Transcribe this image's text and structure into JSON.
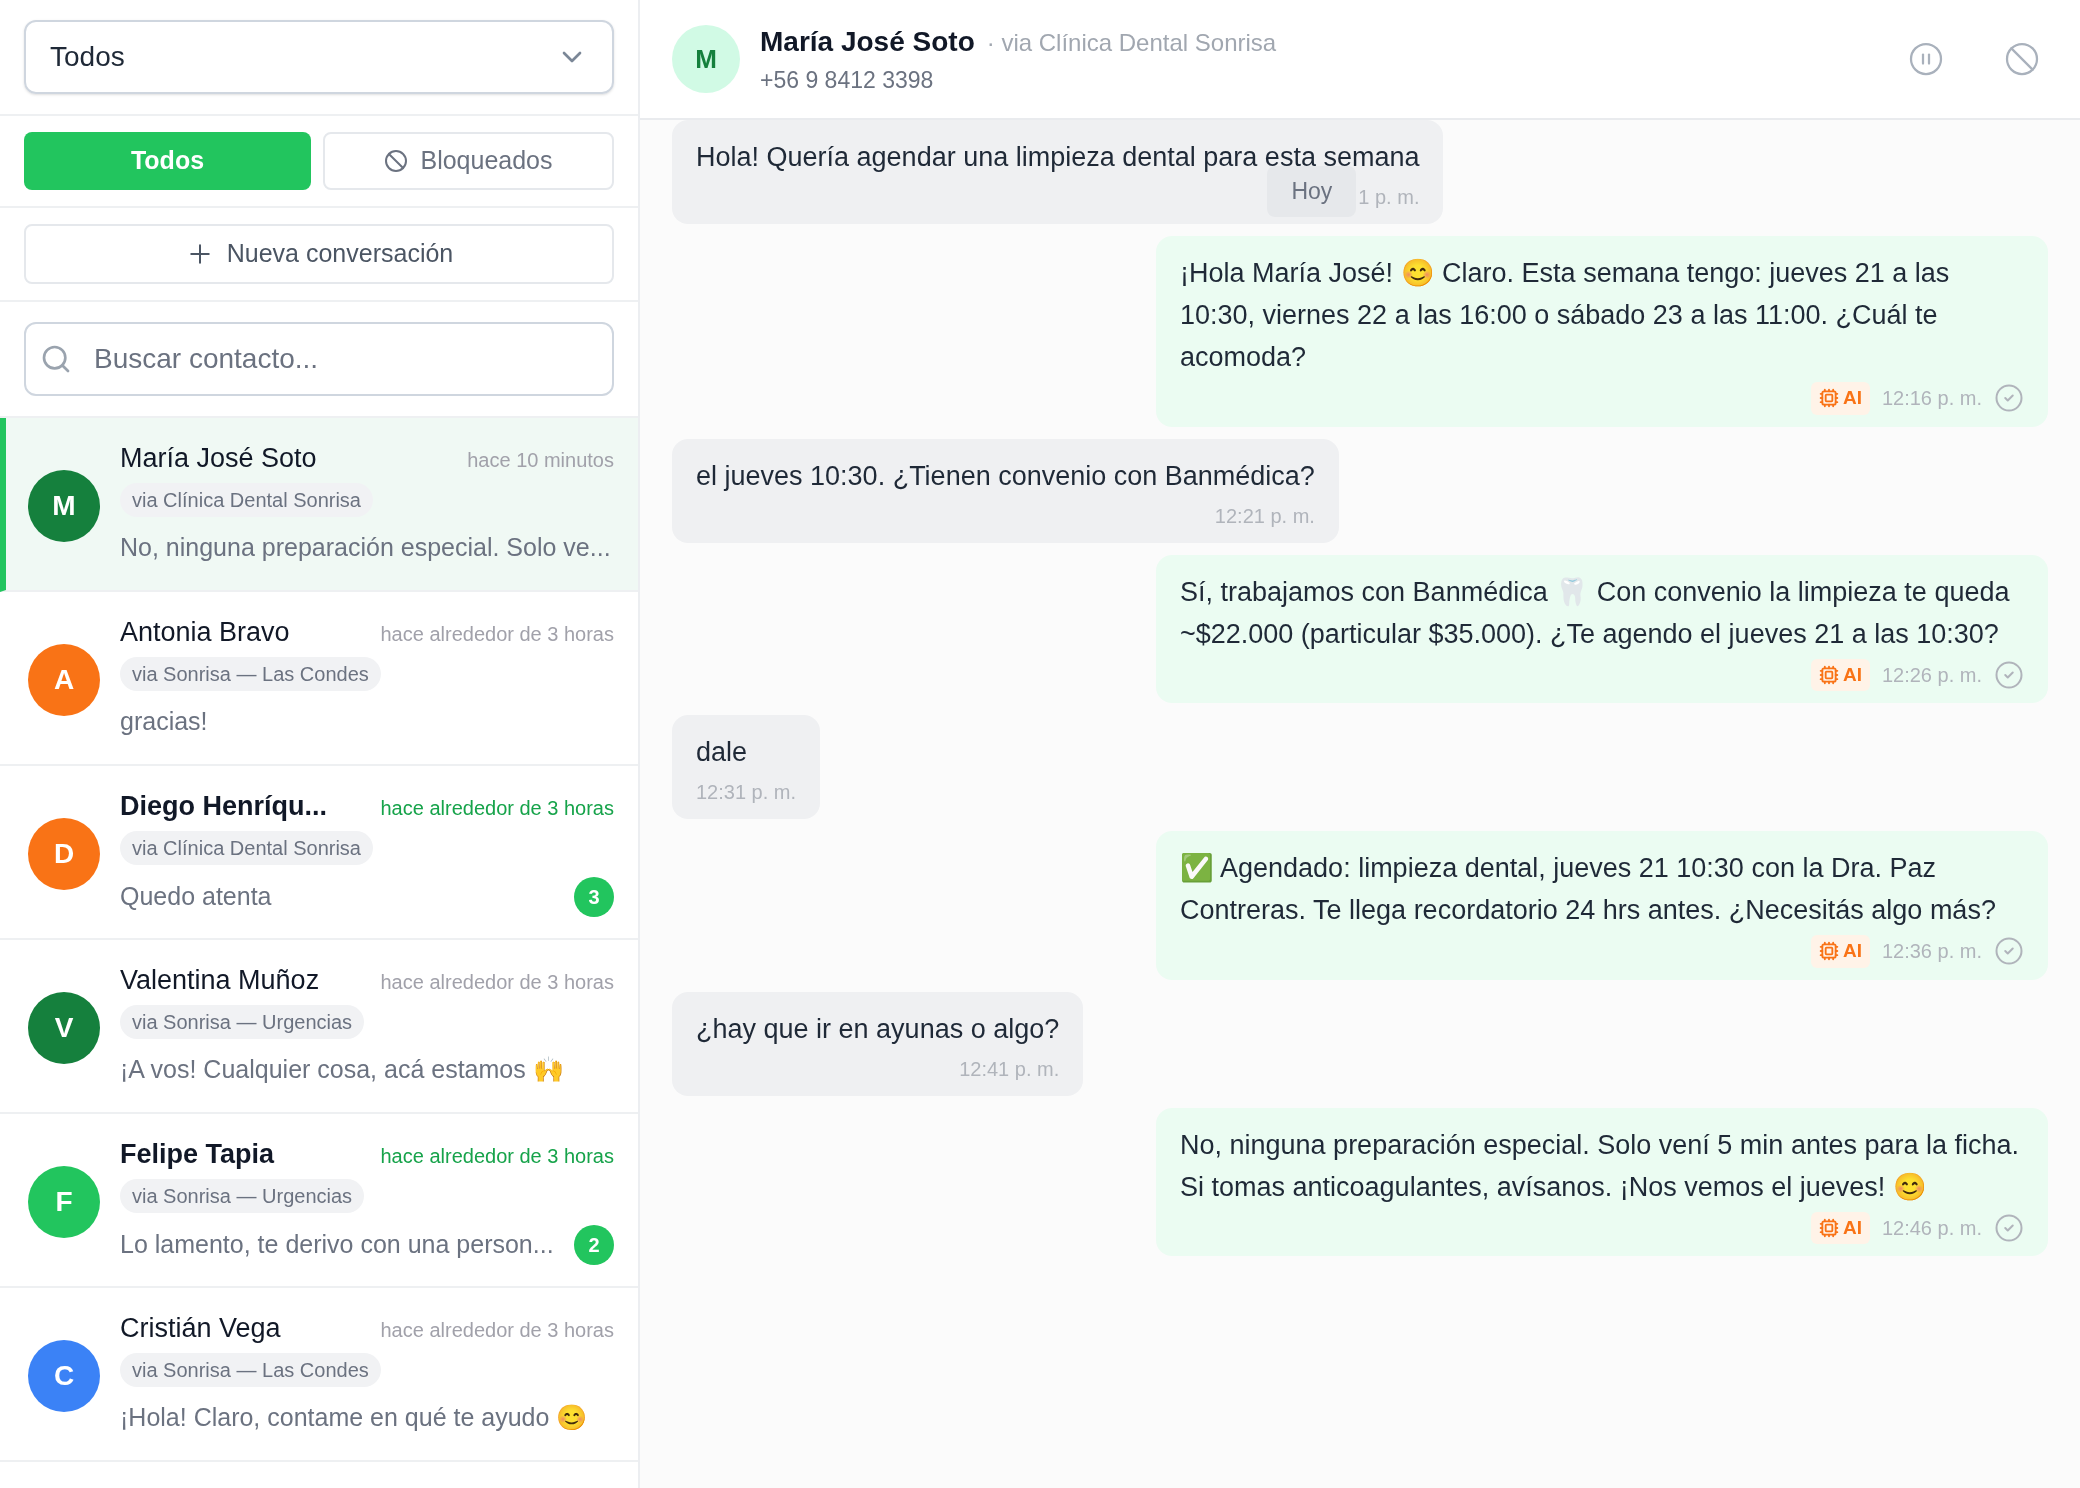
{
  "sidebar": {
    "filter": {
      "value": "Todos"
    },
    "tabs": [
      {
        "label": "Todos",
        "kind": "all",
        "selected": true
      },
      {
        "label": "Bloqueados",
        "kind": "blocked",
        "selected": false
      }
    ],
    "new_button": "Nueva conversación",
    "search": {
      "placeholder": "Buscar contacto..."
    },
    "conversations": [
      {
        "initial": "M",
        "color": "#15803d",
        "name": "María José Soto",
        "time": "hace 10 minutos",
        "channel": "via Clínica Dental Sonrisa",
        "preview": "No, ninguna preparación especial. Solo ve...",
        "selected": true,
        "unread": false
      },
      {
        "initial": "A",
        "color": "#f97316",
        "name": "Antonia Bravo",
        "time": "hace alrededor de 3 horas",
        "channel": "via Sonrisa — Las Condes",
        "preview": "gracias!",
        "selected": false,
        "unread": false
      },
      {
        "initial": "D",
        "color": "#f97316",
        "name": "Diego Henríqu...",
        "time": "hace alrededor de 3 horas",
        "channel": "via Clínica Dental Sonrisa",
        "preview": "Quedo atenta",
        "selected": false,
        "unread": true,
        "count": "3"
      },
      {
        "initial": "V",
        "color": "#15803d",
        "name": "Valentina Muñoz",
        "time": "hace alrededor de 3 horas",
        "channel": "via Sonrisa — Urgencias",
        "preview": "¡A vos! Cualquier cosa, acá estamos 🙌",
        "selected": false,
        "unread": false
      },
      {
        "initial": "F",
        "color": "#22c55e",
        "name": "Felipe Tapia",
        "time": "hace alrededor de 3 horas",
        "channel": "via Sonrisa — Urgencias",
        "preview": "Lo lamento, te derivo con una person...",
        "selected": false,
        "unread": true,
        "count": "2"
      },
      {
        "initial": "C",
        "color": "#3b82f6",
        "name": "Cristián Vega",
        "time": "hace alrededor de 3 horas",
        "channel": "via Sonrisa — Las Condes",
        "preview": "¡Hola! Claro, contame en qué te ayudo 😊",
        "selected": false,
        "unread": false
      }
    ]
  },
  "chat": {
    "header": {
      "initial": "M",
      "name": "María José Soto",
      "channel": "· via Clínica Dental Sonrisa",
      "phone": "+56 9 8412 3398"
    },
    "date_separator": "Hoy",
    "messages": [
      {
        "kind": "in",
        "text": "Hola! Quería agendar una limpieza dental para esta semana",
        "time": "1 p. m."
      },
      {
        "kind": "out",
        "ai_label": "AI",
        "text": "¡Hola María José! 😊 Claro. Esta semana tengo: jueves 21 a las 10:30, viernes 22 a las 16:00 o sábado 23 a las 11:00. ¿Cuál te acomoda?",
        "time": "12:16 p. m."
      },
      {
        "kind": "in",
        "text": "el jueves 10:30. ¿Tienen convenio con Banmédica?",
        "time": "12:21 p. m."
      },
      {
        "kind": "out",
        "ai_label": "AI",
        "text": "Sí, trabajamos con Banmédica 🦷 Con convenio la limpieza te queda ~$22.000 (particular $35.000). ¿Te agendo el jueves 21 a las 10:30?",
        "time": "12:26 p. m."
      },
      {
        "kind": "in",
        "text": "dale",
        "time": "12:31 p. m."
      },
      {
        "kind": "out",
        "ai_label": "AI",
        "text": "✅ Agendado: limpieza dental, jueves 21 10:30 con la Dra. Paz Contreras. Te llega recordatorio 24 hrs antes. ¿Necesitás algo más?",
        "time": "12:36 p. m."
      },
      {
        "kind": "in",
        "text": "¿hay que ir en ayunas o algo?",
        "time": "12:41 p. m."
      },
      {
        "kind": "out",
        "ai_label": "AI",
        "text": "No, ninguna preparación especial. Solo vení 5 min antes para la ficha. Si tomas anticoagulantes, avísanos. ¡Nos vemos el jueves! 😊",
        "time": "12:46 p. m."
      }
    ]
  }
}
